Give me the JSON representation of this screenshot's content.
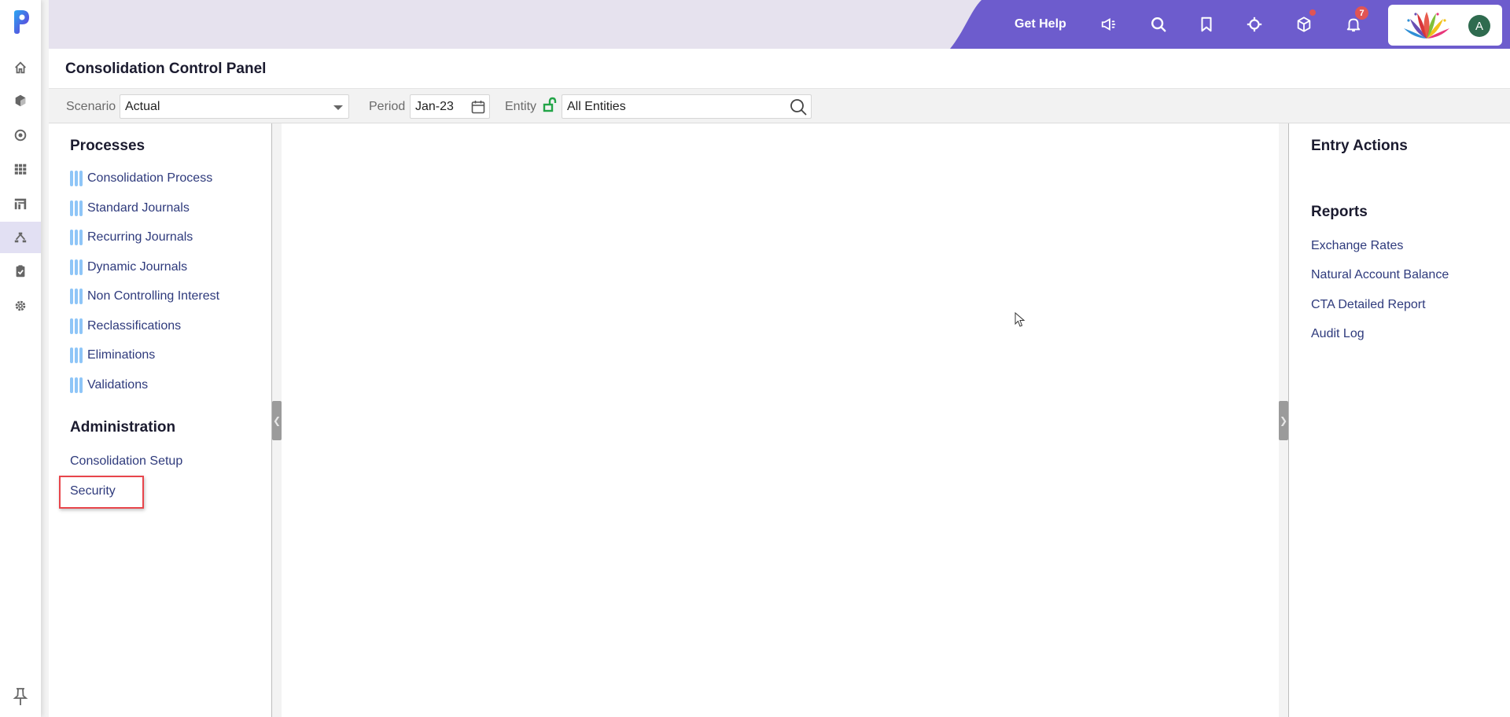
{
  "rail": {
    "logo": "p-logo",
    "items": [
      {
        "icon": "home-icon",
        "label": "Home",
        "active": false
      },
      {
        "icon": "cube-icon",
        "label": "Models",
        "active": false
      },
      {
        "icon": "target-icon",
        "label": "Objectives",
        "active": false
      },
      {
        "icon": "grid-icon",
        "label": "Sheets",
        "active": false
      },
      {
        "icon": "dashboard-icon",
        "label": "Dashboards",
        "active": false
      },
      {
        "icon": "hierarchy-icon",
        "label": "Consolidation",
        "active": true
      },
      {
        "icon": "clipboard-check-icon",
        "label": "Tasks",
        "active": false
      },
      {
        "icon": "gear-icon",
        "label": "Settings",
        "active": false
      }
    ],
    "pin": "pin-icon"
  },
  "header": {
    "get_help": "Get Help",
    "icons": [
      "announcement-icon",
      "search-icon",
      "bookmark-icon",
      "crosshair-icon",
      "box-icon",
      "bell-icon"
    ],
    "notification_count": "7",
    "avatar_initial": "A",
    "accent_color": "#6d5ccd"
  },
  "page": {
    "title": "Consolidation Control Panel"
  },
  "filters": {
    "scenario_label": "Scenario",
    "scenario_value": "Actual",
    "period_label": "Period",
    "period_value": "Jan-23",
    "entity_label": "Entity",
    "entity_value": "All Entities"
  },
  "left": {
    "processes_title": "Processes",
    "processes": [
      "Consolidation Process",
      "Standard Journals",
      "Recurring Journals",
      "Dynamic Journals",
      "Non Controlling Interest",
      "Reclassifications",
      "Eliminations",
      "Validations"
    ],
    "admin_title": "Administration",
    "admin": [
      "Consolidation Setup",
      "Security"
    ]
  },
  "right": {
    "entry_actions_title": "Entry Actions",
    "reports_title": "Reports",
    "reports": [
      "Exchange Rates",
      "Natural Account Balance",
      "CTA Detailed Report",
      "Audit Log"
    ]
  }
}
